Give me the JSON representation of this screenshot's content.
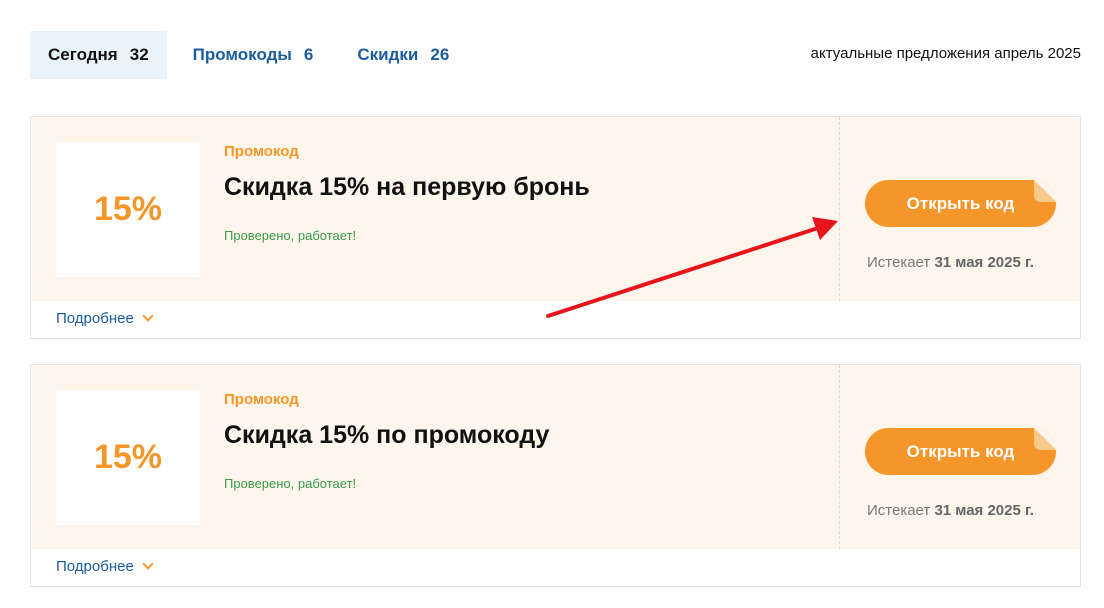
{
  "tabs": [
    {
      "label": "Сегодня",
      "count": "32"
    },
    {
      "label": "Промокоды",
      "count": "6"
    },
    {
      "label": "Скидки",
      "count": "26"
    }
  ],
  "headline": "актуальные предложения апрель 2025",
  "offers": [
    {
      "badge": "15%",
      "type": "Промокод",
      "title": "Скидка 15% на первую бронь",
      "verified": "Проверено, работает!",
      "button": "Открыть код",
      "expires_label": "Истекает",
      "expires_date": "31 мая 2025 г.",
      "more": "Подробнее"
    },
    {
      "badge": "15%",
      "type": "Промокод",
      "title": "Скидка 15% по промокоду",
      "verified": "Проверено, работает!",
      "button": "Открыть код",
      "expires_label": "Истекает",
      "expires_date": "31 мая 2025 г.",
      "more": "Подробнее"
    }
  ],
  "colors": {
    "accent": "#f4962a",
    "link": "#1a5c9e",
    "verified": "#3a9a4a",
    "card_bg": "#fef6ec",
    "active_tab_bg": "#e8f3fb",
    "annotation_arrow": "#e8141c"
  }
}
